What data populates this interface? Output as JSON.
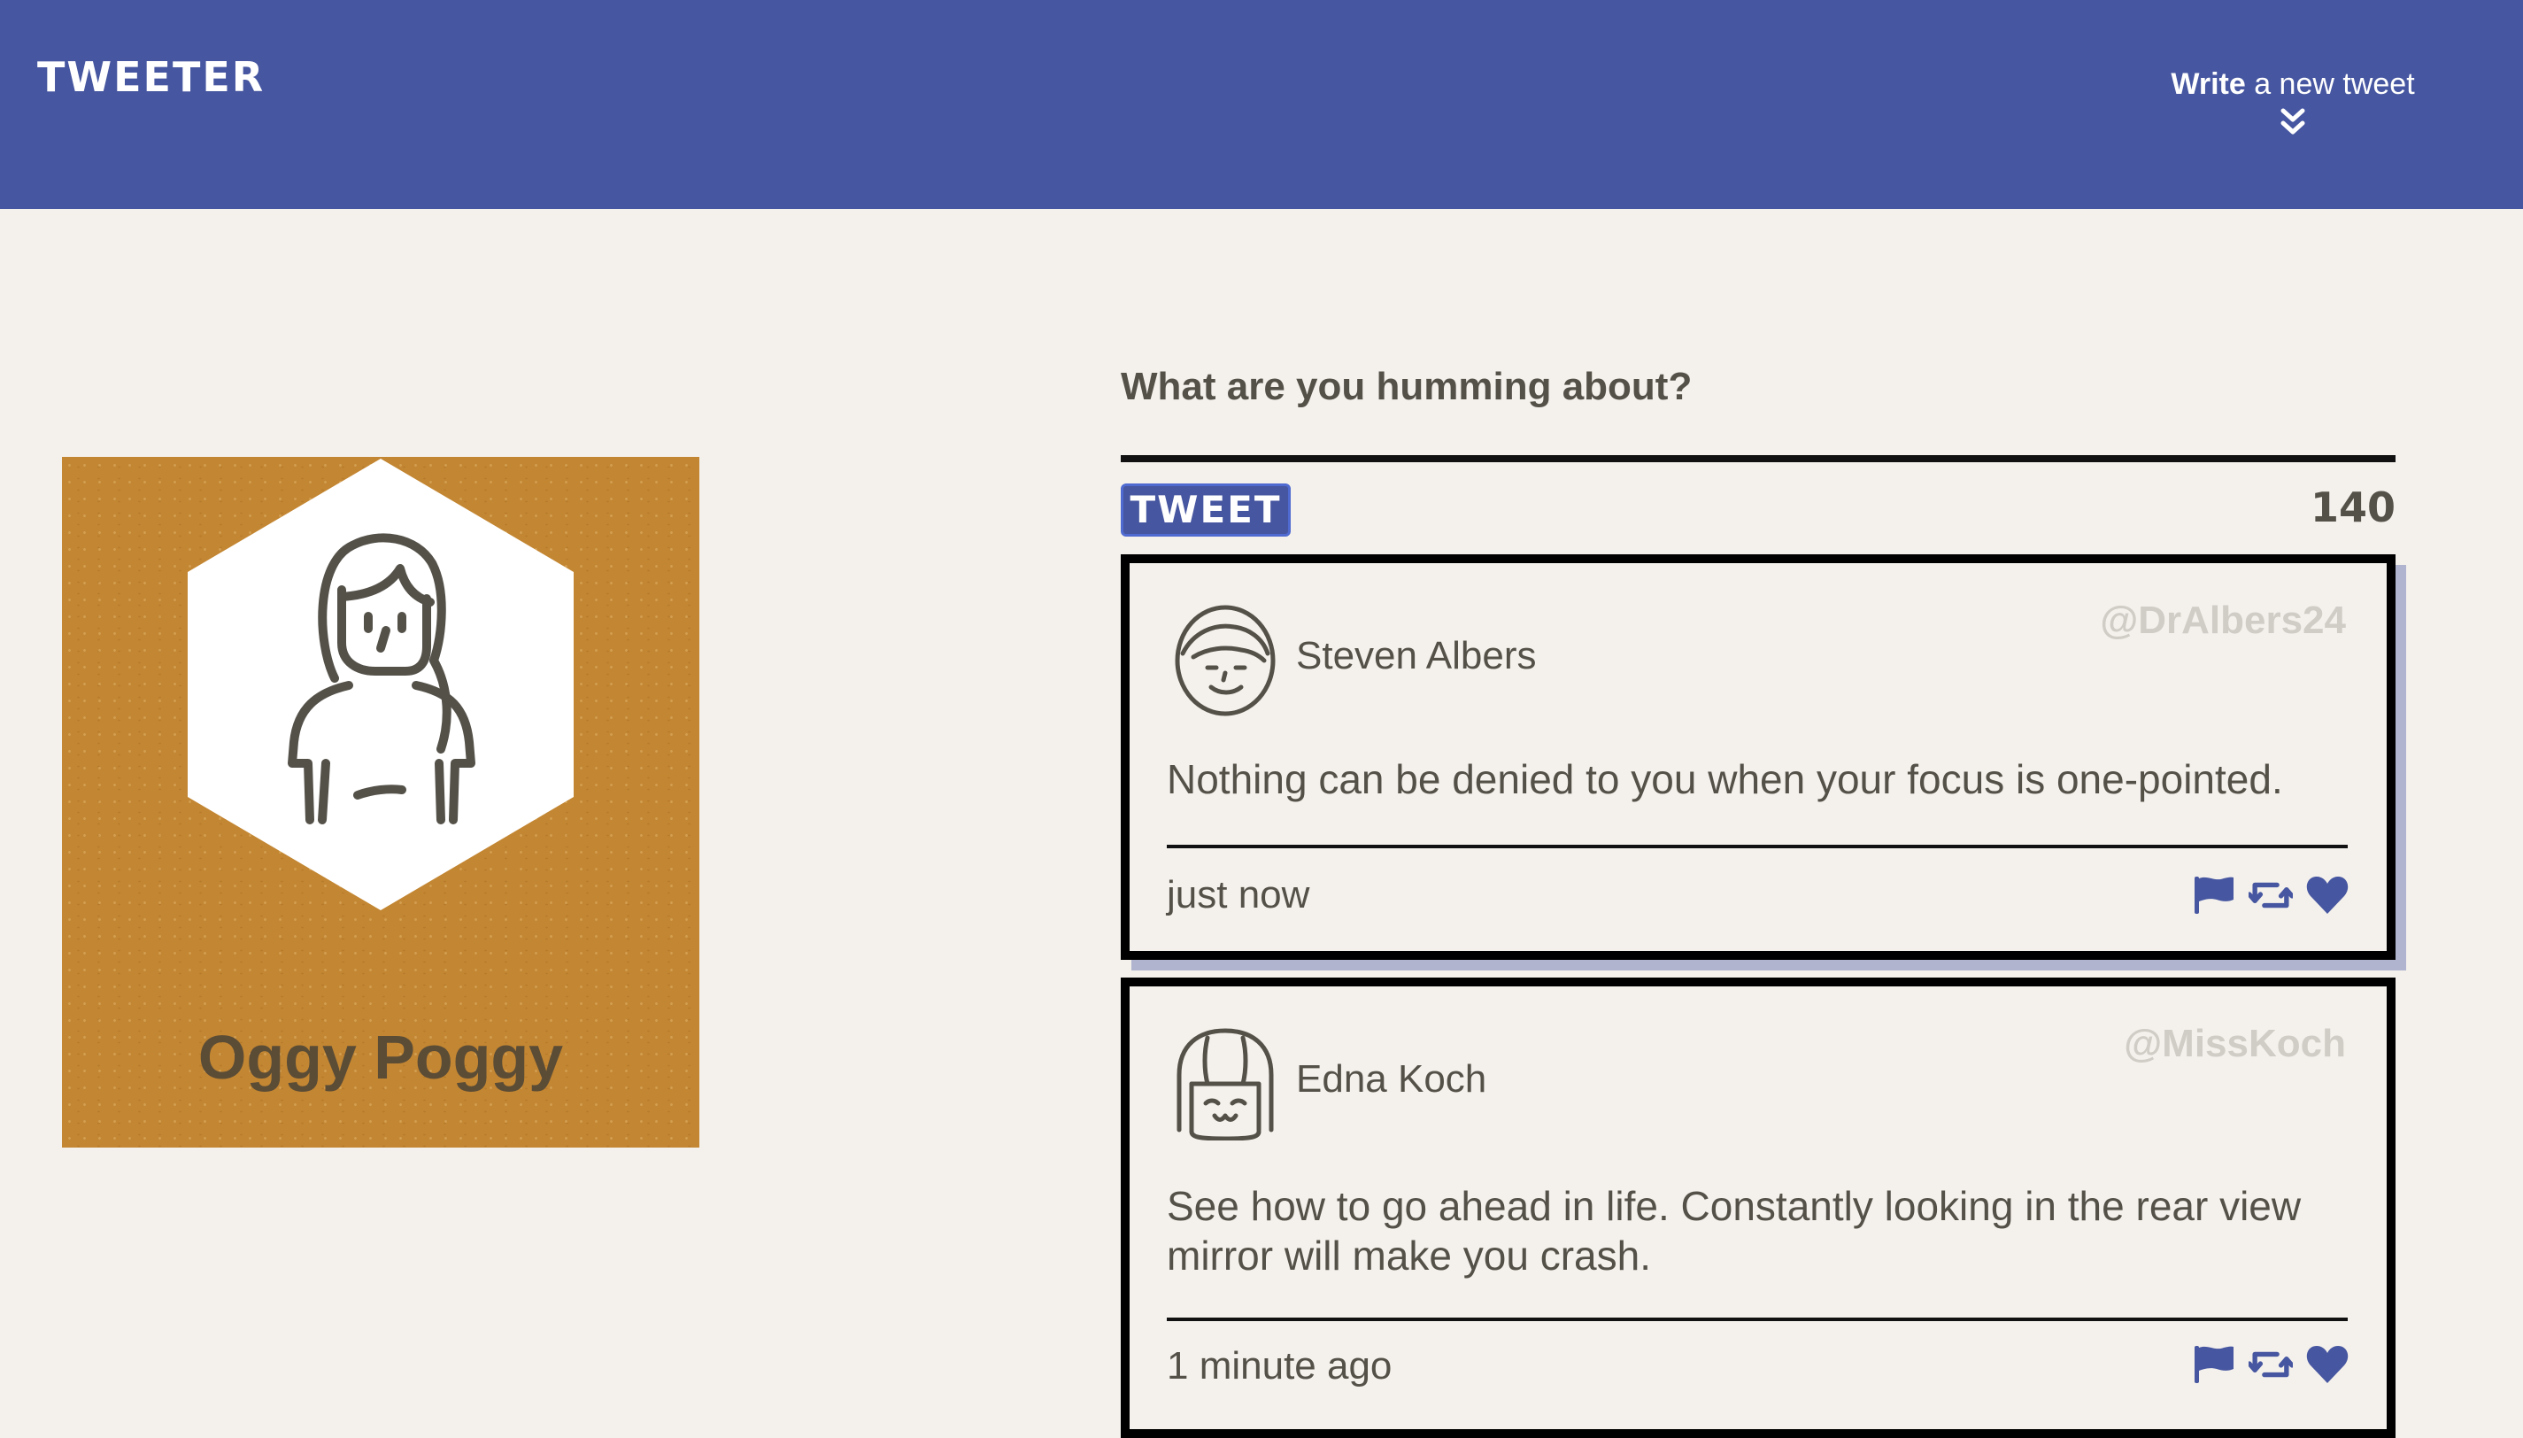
{
  "nav": {
    "brand": "TWEETER",
    "compose_strong": "Write",
    "compose_rest": " a new tweet",
    "compose_icon": "double-chevron-down-icon"
  },
  "profile": {
    "name": "Oggy Poggy",
    "background_color": "#c38632",
    "avatar_icon": "woman-avatar-icon"
  },
  "composer": {
    "prompt": "What are you humming about?",
    "button_label": "TWEET",
    "counter": "140"
  },
  "tweets": [
    {
      "author": "Steven Albers",
      "handle": "@DrAlbers24",
      "text": "Nothing can be denied to you when your focus is one-pointed.",
      "time": "just now",
      "avatar_icon": "man-avatar-icon"
    },
    {
      "author": "Edna Koch",
      "handle": "@MissKoch",
      "text": "See how to go ahead in life. Constantly looking in the rear view mirror will make you crash.",
      "time": "1 minute ago",
      "avatar_icon": "girl-avatar-icon"
    }
  ],
  "colors": {
    "nav": "#4656a0",
    "page": "#f4f1ec",
    "text": "#545149",
    "handle": "#d0ccc6"
  }
}
